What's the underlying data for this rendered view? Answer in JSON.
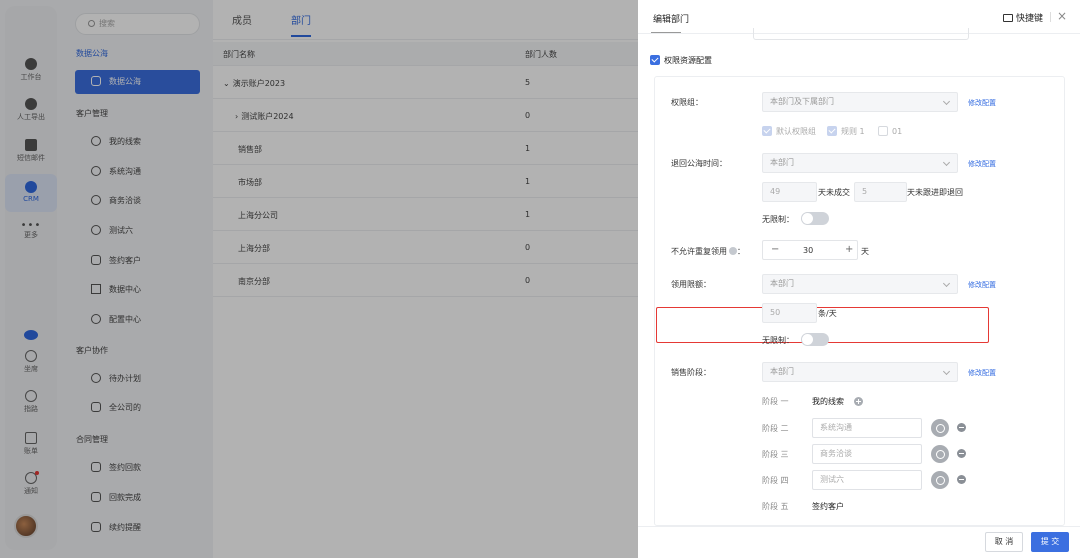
{
  "rail": {
    "items": [
      {
        "label": "工作台"
      },
      {
        "label": "人工导出"
      },
      {
        "label": "短信邮件"
      },
      {
        "label": "CRM"
      },
      {
        "label": "更多"
      },
      {
        "label": "坐席"
      },
      {
        "label": "指路"
      },
      {
        "label": "账单"
      },
      {
        "label": "通知"
      }
    ]
  },
  "sidebar": {
    "search_placeholder": "搜索",
    "groups": [
      {
        "title": "数据公海"
      },
      {
        "title": "客户管理"
      },
      {
        "title": "客户协作"
      },
      {
        "title": "合同管理"
      }
    ],
    "items": [
      {
        "label": "数据公海"
      },
      {
        "label": "我的线索"
      },
      {
        "label": "系统沟通"
      },
      {
        "label": "商务洽谈"
      },
      {
        "label": "测试六"
      },
      {
        "label": "签约客户"
      },
      {
        "label": "数据中心"
      },
      {
        "label": "配置中心"
      },
      {
        "label": "待办计划"
      },
      {
        "label": "全公司的"
      },
      {
        "label": "签约回款"
      },
      {
        "label": "回款完成"
      },
      {
        "label": "续约提醒"
      }
    ]
  },
  "main": {
    "tabs": [
      {
        "label": "成员"
      },
      {
        "label": "部门"
      }
    ],
    "columns": [
      "部门名称",
      "部门人数"
    ],
    "rows": [
      {
        "name": "演示账户2023",
        "count": "5",
        "prefix": "⌄"
      },
      {
        "name": "测试账户2024",
        "count": "0",
        "prefix": "›"
      },
      {
        "name": "销售部",
        "count": "1",
        "prefix": ""
      },
      {
        "name": "市场部",
        "count": "1",
        "prefix": ""
      },
      {
        "name": "上海分公司",
        "count": "1",
        "prefix": ""
      },
      {
        "name": "上海分部",
        "count": "0",
        "prefix": ""
      },
      {
        "name": "南京分部",
        "count": "0",
        "prefix": ""
      }
    ]
  },
  "drawer": {
    "title": "编辑部门",
    "shortcut_label": "快捷键",
    "close_label": "×",
    "checkbox_label": "权限资源配置",
    "fields": {
      "permission_group": {
        "label": "权限组：",
        "value": "本部门及下属部门",
        "link": "修改配置",
        "options": [
          {
            "label": "默认权限组"
          },
          {
            "label": "规则 1"
          },
          {
            "label": "01"
          }
        ]
      },
      "return_time": {
        "label": "退回公海时间：",
        "value": "本部门",
        "link": "修改配置",
        "days_no_deal": "49",
        "no_deal_text": "天未成交",
        "days_no_follow": "5",
        "no_follow_text": "天未跟进即退回",
        "unlimited_label": "无限制："
      },
      "no_repeat": {
        "label": "不允许重复领用",
        "colon": "：",
        "minus": "−",
        "value": "30",
        "plus": "+",
        "unit": "天"
      },
      "claim_limit": {
        "label": "领用限额：",
        "value": "本部门",
        "link": "修改配置",
        "quota": "50",
        "unit": "条/天",
        "unlimited_label": "无限制："
      },
      "sales_stage": {
        "label": "销售阶段：",
        "value": "本部门",
        "link": "修改配置",
        "stages": [
          {
            "label": "阶段 一",
            "value": "我的线索"
          },
          {
            "label": "阶段 二",
            "value": "系统沟通"
          },
          {
            "label": "阶段 三",
            "value": "商务洽谈"
          },
          {
            "label": "阶段 四",
            "value": "测试六"
          },
          {
            "label": "阶段 五",
            "value": "签约客户"
          }
        ]
      }
    },
    "footer": {
      "cancel": "取 消",
      "submit": "提 交"
    }
  }
}
